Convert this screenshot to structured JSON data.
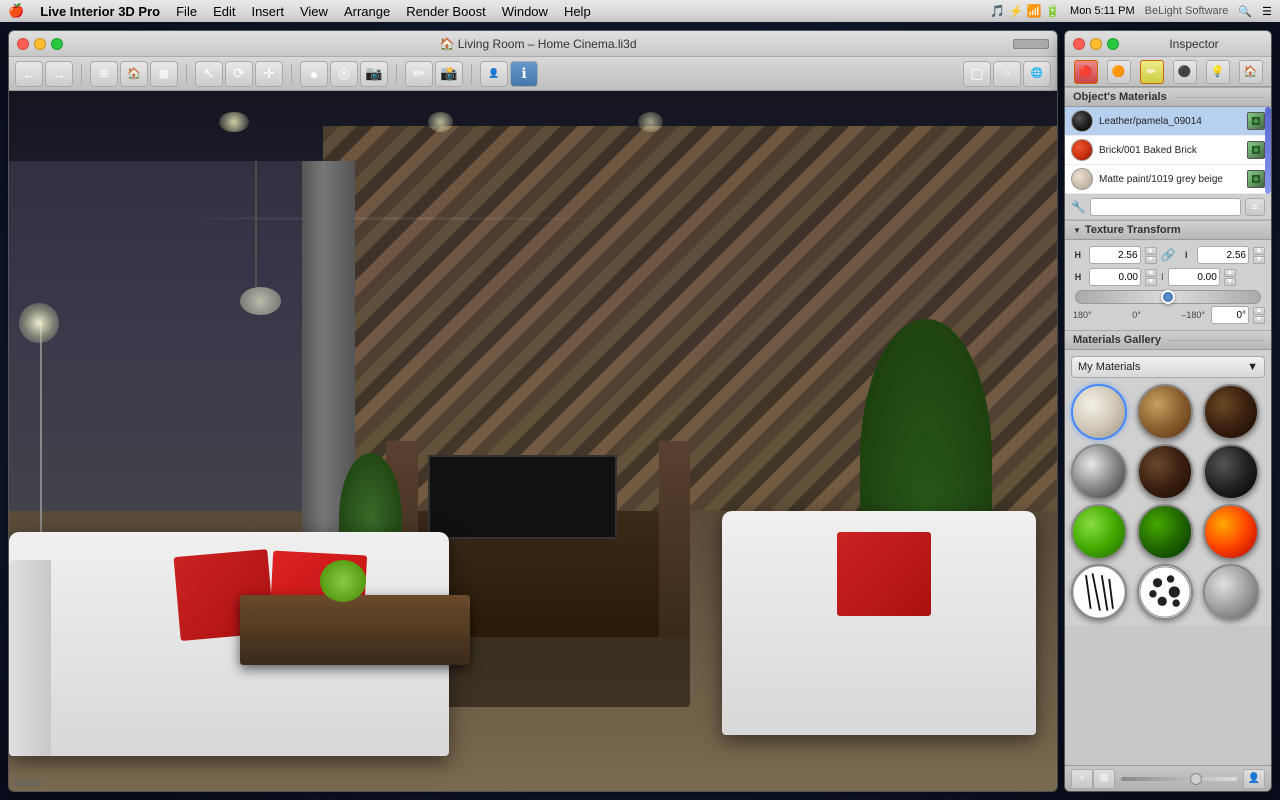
{
  "menubar": {
    "apple": "🍎",
    "items": [
      {
        "label": "Live Interior 3D Pro"
      },
      {
        "label": "File"
      },
      {
        "label": "Edit"
      },
      {
        "label": "Insert"
      },
      {
        "label": "View"
      },
      {
        "label": "Arrange"
      },
      {
        "label": "Render Boost"
      },
      {
        "label": "Window"
      },
      {
        "label": "Help"
      }
    ],
    "right": {
      "time": "Mon 5:11 PM",
      "brand": "BeLight Software"
    }
  },
  "main_window": {
    "title": "🏠 Living Room – Home Cinema.li3d",
    "toolbar": {
      "buttons": [
        {
          "name": "back",
          "icon": "←"
        },
        {
          "name": "forward",
          "icon": "→"
        },
        {
          "name": "floor-plan",
          "icon": "⊞"
        },
        {
          "name": "3d-view",
          "icon": "🏠"
        },
        {
          "name": "render",
          "icon": "▦"
        },
        {
          "name": "select",
          "icon": "↖"
        },
        {
          "name": "orbit",
          "icon": "⟳"
        },
        {
          "name": "move",
          "icon": "✛"
        },
        {
          "name": "record-dot",
          "icon": "●"
        },
        {
          "name": "orbit2",
          "icon": "◎"
        },
        {
          "name": "camera",
          "icon": "📷"
        },
        {
          "name": "draw",
          "icon": "✏"
        },
        {
          "name": "snapshot",
          "icon": "📸"
        },
        {
          "name": "walk",
          "icon": "🚶"
        },
        {
          "name": "info",
          "icon": "ℹ"
        },
        {
          "name": "framing",
          "icon": "▢"
        },
        {
          "name": "home-view",
          "icon": "🏠"
        },
        {
          "name": "outdoor",
          "icon": "🌐"
        }
      ]
    }
  },
  "inspector": {
    "title": "Inspector",
    "tabs": [
      {
        "name": "materials",
        "icon": "🔴",
        "active": true
      },
      {
        "name": "orange-sphere",
        "icon": "🟠"
      },
      {
        "name": "pencil",
        "icon": "✏"
      },
      {
        "name": "dark-sphere",
        "icon": "⚫"
      },
      {
        "name": "light",
        "icon": "💡"
      },
      {
        "name": "house",
        "icon": "🏠"
      }
    ],
    "objects_materials_label": "Object's Materials",
    "materials": [
      {
        "name": "Leather/pamela_09014",
        "swatch_color": "#333333",
        "swatch_type": "dark",
        "selected": true
      },
      {
        "name": "Brick/001 Baked Brick",
        "swatch_color": "#cc3300",
        "swatch_type": "red",
        "selected": false
      },
      {
        "name": "Matte paint/1019 grey beige",
        "swatch_color": "#ddccbb",
        "swatch_type": "light",
        "selected": false
      }
    ],
    "texture_transform": {
      "label": "Texture Transform",
      "scale_x": "2.56",
      "scale_y": "2.56",
      "offset_x": "0.00",
      "offset_y": "0.00",
      "rotation": "0°",
      "rot_left": "180°",
      "rot_center": "0°",
      "rot_right": "–180°",
      "link_icon": "🔗",
      "row1_label_left": "H",
      "row1_label_right": "I",
      "row2_label_left": "H",
      "row2_label_right": "I"
    },
    "gallery": {
      "label": "Materials Gallery",
      "dropdown_value": "My Materials",
      "items": [
        {
          "name": "white-plaster",
          "class": "mat-white-plaster"
        },
        {
          "name": "wood-light",
          "class": "mat-wood-light"
        },
        {
          "name": "dark-wood",
          "class": "mat-dark-wood"
        },
        {
          "name": "chrome",
          "class": "mat-chrome"
        },
        {
          "name": "leather",
          "class": "mat-leather"
        },
        {
          "name": "dark-metal",
          "class": "mat-dark-metal"
        },
        {
          "name": "green-bright",
          "class": "mat-green-bright"
        },
        {
          "name": "green-dark",
          "class": "mat-green-dark"
        },
        {
          "name": "fire",
          "class": "mat-fire"
        },
        {
          "name": "zebra",
          "class": "mat-zebra"
        },
        {
          "name": "dalmatian",
          "class": "mat-dalmatian"
        },
        {
          "name": "silver",
          "class": "mat-silver"
        }
      ]
    },
    "bottom_bar": {
      "add_btn": "+",
      "remove_btn": "–",
      "person_icon": "👤"
    }
  }
}
